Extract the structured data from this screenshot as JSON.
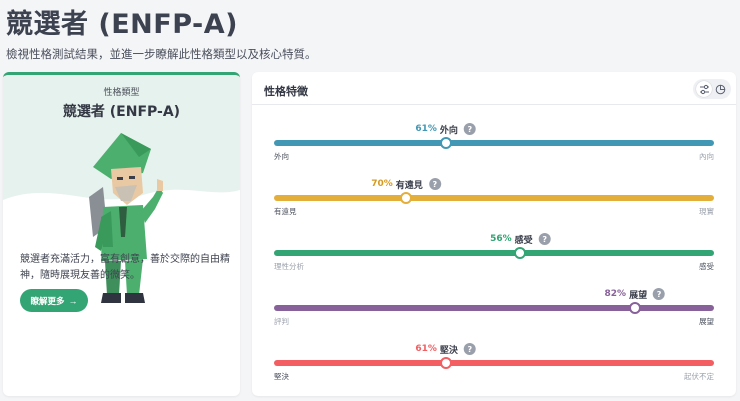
{
  "header": {
    "title": "競選者 (ENFP-A)",
    "subtitle": "檢視性格測試結果，並進一步瞭解此性格類型以及核心特質。"
  },
  "left_card": {
    "type_label": "性格類型",
    "type_name": "競選者 (ENFP-A)",
    "description": "競選者充滿活力，富有創意，善於交際的自由精神，隨時展現友善的微笑。",
    "learn_more_label": "瞭解更多",
    "accent_color": "#33a474",
    "avatar_icon": "campaigner-character-icon"
  },
  "right_card": {
    "title": "性格特徵",
    "view_toggle": [
      "sliders-icon",
      "pie-chart-icon"
    ],
    "traits": [
      {
        "percent": "61%",
        "name": "外向",
        "position": 0.39,
        "left_label": "外向",
        "right_label": "內向",
        "color": "#4298b4",
        "pct_color": "#4298b4",
        "right_muted": true
      },
      {
        "percent": "70%",
        "name": "有遠見",
        "position": 0.3,
        "left_label": "有遠見",
        "right_label": "現實",
        "color": "#e4ae3a",
        "pct_color": "#d69a1f",
        "right_muted": true
      },
      {
        "percent": "56%",
        "name": "感受",
        "position": 0.56,
        "left_label": "理性分析",
        "right_label": "感受",
        "color": "#33a474",
        "pct_color": "#33a474",
        "left_muted": true
      },
      {
        "percent": "82%",
        "name": "展望",
        "position": 0.82,
        "left_label": "評判",
        "right_label": "展望",
        "color": "#88619a",
        "pct_color": "#88619a",
        "left_muted": true
      },
      {
        "percent": "61%",
        "name": "堅決",
        "position": 0.39,
        "left_label": "堅決",
        "right_label": "起伏不定",
        "color": "#f25e62",
        "pct_color": "#f25e62",
        "right_muted": true
      }
    ]
  }
}
